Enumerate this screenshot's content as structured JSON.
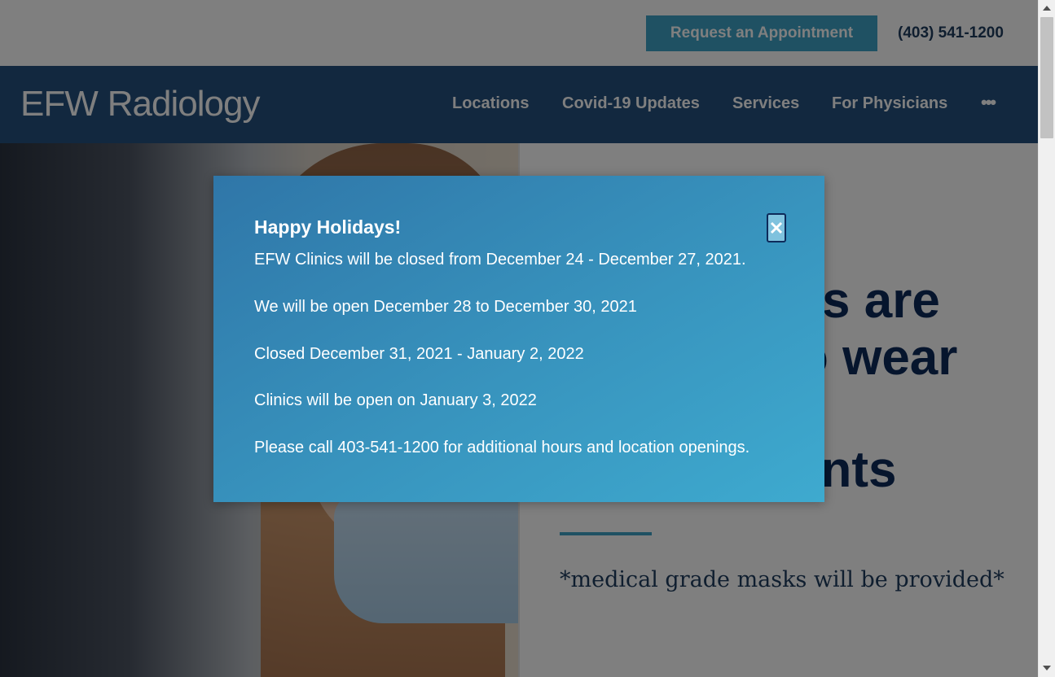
{
  "header": {
    "appointment_label": "Request an Appointment",
    "phone": "(403) 541-1200"
  },
  "brand": {
    "logo_efw": "EFW",
    "logo_radiology": "Radiology"
  },
  "nav": {
    "items": [
      {
        "label": "Locations"
      },
      {
        "label": "Covid-19 Updates"
      },
      {
        "label": "Services"
      },
      {
        "label": "For Physicians"
      }
    ],
    "more_label": "•••"
  },
  "hero": {
    "heading_line1": "s are",
    "heading_line2": "o wear",
    "heading_line3": "ents",
    "note": "*medical grade masks will be provided*"
  },
  "modal": {
    "title": "Happy Holidays!",
    "lines": [
      "EFW Clinics will be closed from December 24 - December 27, 2021.",
      "We will be open December 28 to December 30, 2021",
      "Closed December 31, 2021 - January 2, 2022",
      "Clinics will be open on January 3, 2022",
      "Please call 403-541-1200 for additional hours and location openings."
    ]
  },
  "colors": {
    "accent": "#3fa3c6",
    "navy": "#24517e",
    "heading": "#0d2a5a"
  },
  "icons": {
    "close": "close-icon",
    "scroll_up": "arrow-up-icon",
    "scroll_down": "arrow-down-icon"
  }
}
